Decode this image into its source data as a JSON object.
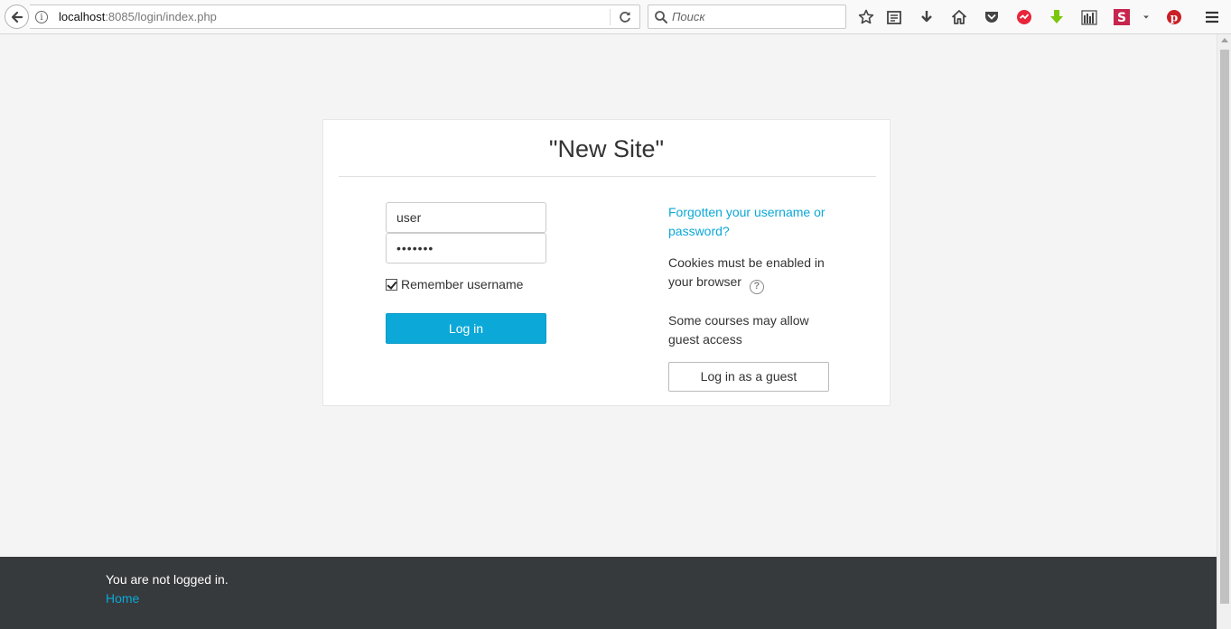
{
  "browser": {
    "url_host": "localhost",
    "url_rest": ":8085/login/index.php",
    "search_placeholder": "Поиск",
    "toolbar_icons": [
      "bookmark-star-icon",
      "reader-view-icon",
      "downloads-icon",
      "home-icon",
      "pocket-icon",
      "extension-red-icon",
      "extension-download-green-icon",
      "library-icon",
      "extension-s-icon",
      "overflow-dropdown-icon",
      "pinterest-icon",
      "hamburger-menu-icon"
    ]
  },
  "login": {
    "site_title": "\"New Site\"",
    "username_value": "user",
    "password_value": "•••••••",
    "remember_label": "Remember username",
    "remember_checked": true,
    "login_button": "Log in",
    "forgot_link": "Forgotten your username or password?",
    "cookies_note": "Cookies must be enabled in your browser",
    "guest_note": "Some courses may allow guest access",
    "guest_button": "Log in as a guest"
  },
  "footer": {
    "status": "You are not logged in.",
    "home_link": "Home"
  },
  "colors": {
    "accent": "#0ba8d8",
    "footer_bg": "#373a3c",
    "page_bg": "#f4f4f4"
  }
}
